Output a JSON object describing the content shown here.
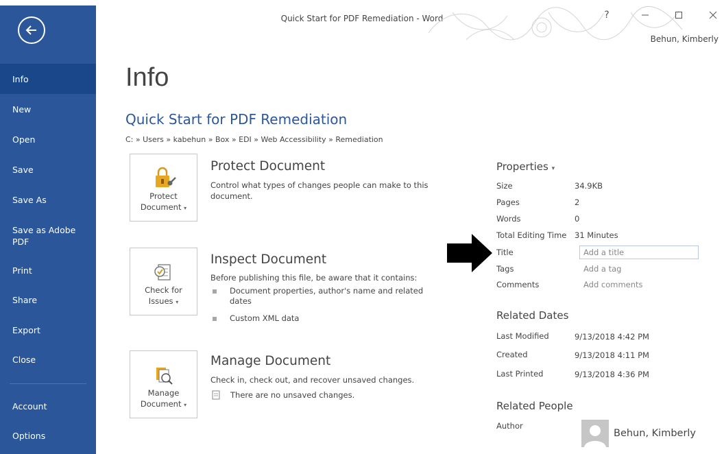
{
  "window": {
    "title": "Quick Start for PDF Remediation - Word",
    "help_label": "?",
    "user_name": "Behun, Kimberly"
  },
  "sidebar": {
    "items": [
      {
        "label": "Info"
      },
      {
        "label": "New"
      },
      {
        "label": "Open"
      },
      {
        "label": "Save"
      },
      {
        "label": "Save As"
      },
      {
        "label": "Save as Adobe PDF"
      },
      {
        "label": "Print"
      },
      {
        "label": "Share"
      },
      {
        "label": "Export"
      },
      {
        "label": "Close"
      },
      {
        "label": "Account"
      },
      {
        "label": "Options"
      }
    ],
    "active": "Info"
  },
  "main": {
    "page_title": "Info",
    "doc_title": "Quick Start for PDF Remediation",
    "path": "C: » Users » kabehun » Box » EDI » Web Accessibility » Remediation",
    "sections": {
      "protect": {
        "button_line1": "Protect",
        "button_line2": "Document",
        "title": "Protect Document",
        "desc": "Control what types of changes people can make to this document."
      },
      "inspect": {
        "button_line1": "Check for",
        "button_line2": "Issues",
        "title": "Inspect Document",
        "desc": "Before publishing this file, be aware that it contains:",
        "bullets": [
          "Document properties, author's name and related dates",
          "Custom XML data"
        ]
      },
      "manage": {
        "button_line1": "Manage",
        "button_line2": "Document",
        "title": "Manage Document",
        "desc": "Check in, check out, and recover unsaved changes.",
        "note": "There are no unsaved changes."
      }
    }
  },
  "properties": {
    "heading": "Properties",
    "size_label": "Size",
    "size_value": "34.9KB",
    "pages_label": "Pages",
    "pages_value": "2",
    "words_label": "Words",
    "words_value": "0",
    "editing_label": "Total Editing Time",
    "editing_value": "31 Minutes",
    "title_label": "Title",
    "title_placeholder": "Add a title",
    "tags_label": "Tags",
    "tags_placeholder": "Add a tag",
    "comments_label": "Comments",
    "comments_placeholder": "Add comments"
  },
  "related_dates": {
    "heading": "Related Dates",
    "last_modified_label": "Last Modified",
    "last_modified_value": "9/13/2018 4:42 PM",
    "created_label": "Created",
    "created_value": "9/13/2018 4:11 PM",
    "last_printed_label": "Last Printed",
    "last_printed_value": "9/13/2018 4:36 PM"
  },
  "related_people": {
    "heading": "Related People",
    "author_label": "Author",
    "author_name": "Behun, Kimberly"
  },
  "colors": {
    "sidebar_bg": "#2b579a",
    "sidebar_active": "#19478a",
    "doc_title": "#2b579a"
  }
}
